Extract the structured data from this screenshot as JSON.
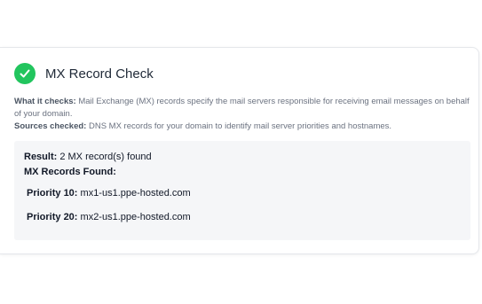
{
  "check": {
    "title": "MX Record Check",
    "status": "pass",
    "accent_color": "#22c55e",
    "status_icon": "checkmark-icon"
  },
  "description": {
    "what_label": "What it checks:",
    "what_text": "Mail Exchange (MX) records specify the mail servers responsible for receiving email messages on behalf of your domain.",
    "sources_label": "Sources checked:",
    "sources_text": "DNS MX records for your domain to identify mail server priorities and hostnames."
  },
  "result": {
    "label": "Result:",
    "text": "2 MX record(s) found",
    "records_heading": "MX Records Found:",
    "records": [
      {
        "priority_label": "Priority 10:",
        "host": "mx1-us1.ppe-hosted.com"
      },
      {
        "priority_label": "Priority 20:",
        "host": "mx2-us1.ppe-hosted.com"
      }
    ]
  }
}
